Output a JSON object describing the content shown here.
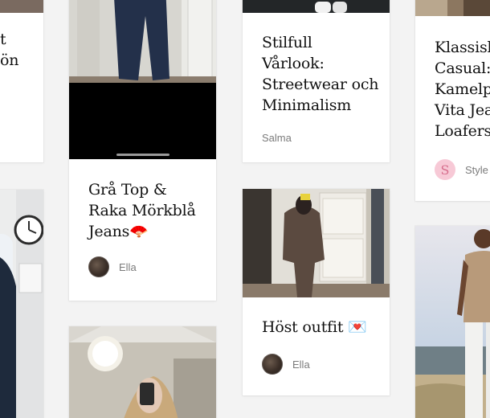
{
  "cards": {
    "left_top": {
      "title_line1": "t",
      "title_line2": "ön"
    },
    "grey_top": {
      "title": "Grå Top & Raka Mörkblå Jeans",
      "title_line1": "Grå Top &",
      "title_line2": "Raka Mörkblå",
      "title_line3": "Jeans",
      "title_emoji": "🪭",
      "author": "Ella"
    },
    "stilfull": {
      "title_line1": "Stilfull",
      "title_line2": "Vårlook:",
      "title_line3": "Streetwear och",
      "title_line4": "Minimalism",
      "author": "Salma"
    },
    "host_outfit": {
      "title": "Höst outfit",
      "title_emoji": "💌",
      "author": "Ella"
    },
    "klassisk": {
      "title_line1": "Klassisk",
      "title_line2": "Casual:",
      "title_line3": "Kamelp",
      "title_line4": "Vita Jea",
      "title_line5": "Loafers",
      "avatar_letter": "S",
      "author": "Style"
    }
  },
  "colors": {
    "page_bg": "#f3f3f3",
    "card_bg": "#ffffff",
    "avatar_s_bg": "#f7c9d6",
    "avatar_s_fg": "#d66d8c",
    "author_text": "#7b7b7b"
  },
  "icons": [
    "fan-emoji-icon",
    "love-letter-emoji-icon"
  ]
}
